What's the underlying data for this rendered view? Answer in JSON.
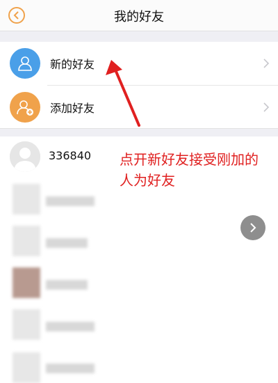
{
  "header": {
    "title": "我的好友"
  },
  "menu": [
    {
      "label": "新的好友",
      "icon": "person-icon",
      "color": "#4a9fe8"
    },
    {
      "label": "添加好友",
      "icon": "add-person-icon",
      "color": "#f0a24b"
    }
  ],
  "friends": [
    {
      "name": "336840"
    }
  ],
  "annotation": {
    "text": "点开新好友接受刚加的人为好友"
  },
  "colors": {
    "accent": "#f0a24b",
    "blue": "#4a9fe8",
    "annotation_red": "#e02020"
  }
}
